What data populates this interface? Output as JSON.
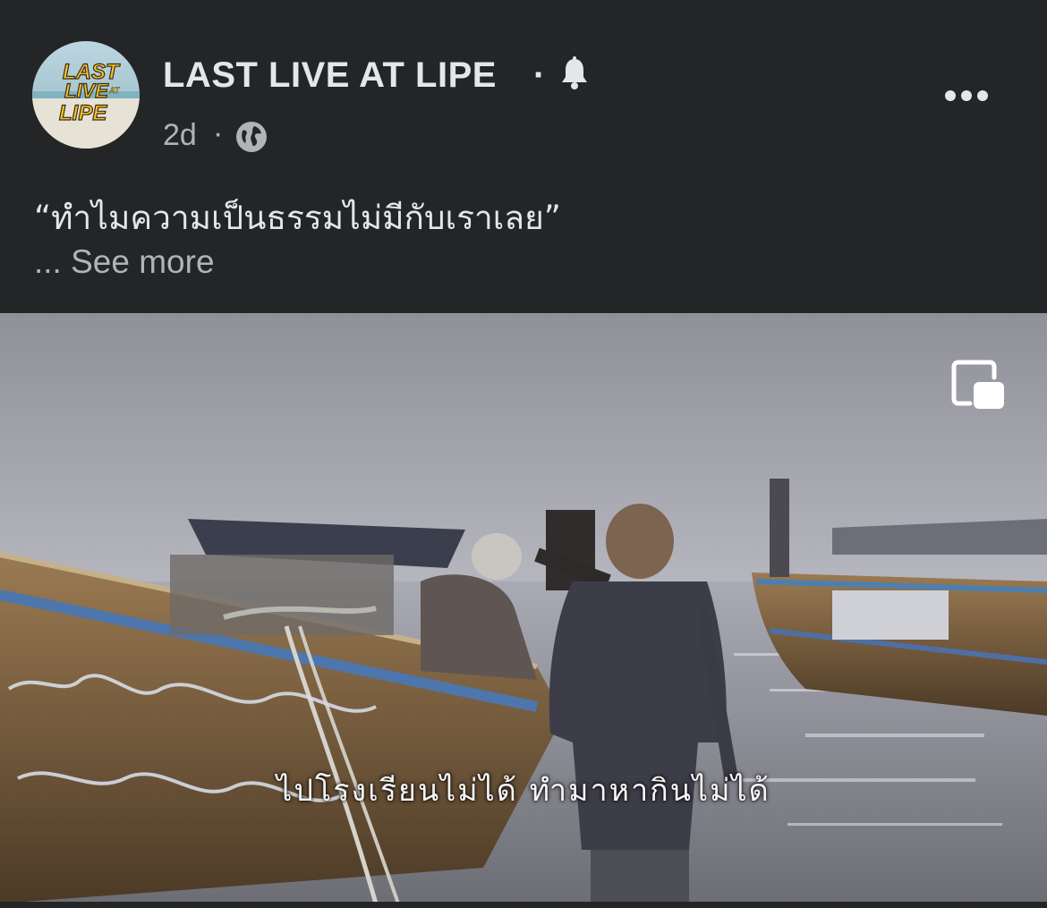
{
  "page": {
    "name": "LAST LIVE AT LIPE",
    "separator": "·",
    "avatar_text": [
      "LAST",
      "LIVE",
      "AT",
      "LIPE"
    ]
  },
  "post": {
    "time": "2d",
    "meta_separator": "·",
    "text": "“ทำไมความเป็นธรรมไม่มีกับเราเลย”",
    "see_more_prefix": "...",
    "see_more": "See more"
  },
  "video": {
    "subtitle": "ไปโรงเรียนไม่ได้ ทำมาหากินไม่ได้"
  },
  "icons": {
    "bell": "bell-icon",
    "globe": "globe-icon",
    "more": "more-options-icon",
    "pip": "picture-in-picture-icon"
  },
  "colors": {
    "background": "#242526",
    "text_primary": "#e4e6eb",
    "text_secondary": "#b0b3b8"
  }
}
